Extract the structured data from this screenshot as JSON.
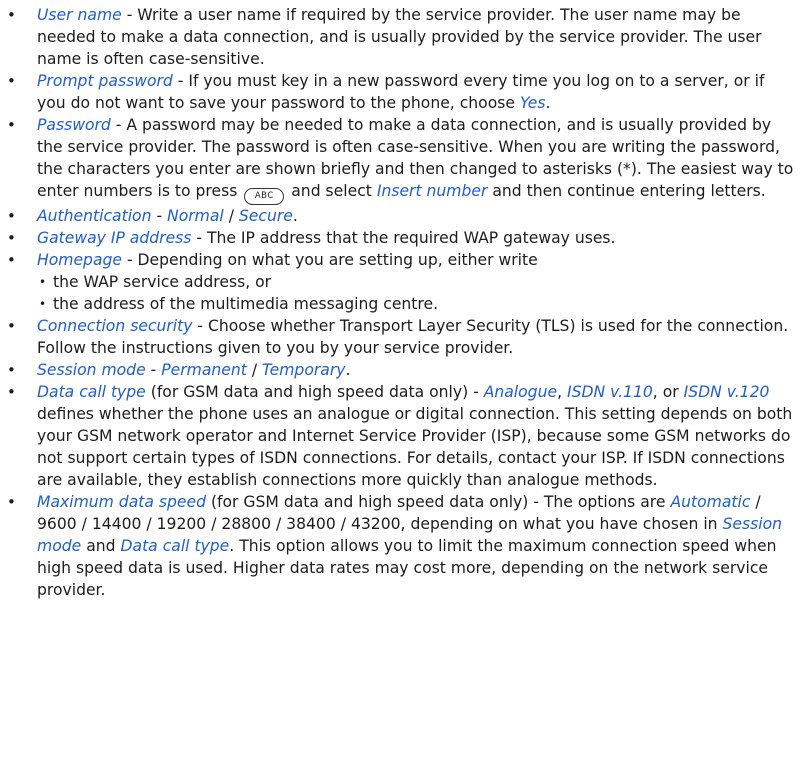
{
  "key_label": "ABC",
  "items": [
    {
      "title": "User name",
      "text": " - Write a user name if required by the service provider. The user name may be needed to make a data connection, and is usually provided by the service provider. The user name is often case-sensitive."
    },
    {
      "title": "Prompt password",
      "text": " - If you must key in a new password every time you log on to a server, or if you do not want to save your password to the phone, choose ",
      "opt": "Yes",
      "end": "."
    },
    {
      "title": "Password",
      "text1": " - A password may be needed to make a data connection, and is usually provided by the service provider. The password is often case-sensitive. When you are writing the password, the characters you enter are shown briefly and then changed to asterisks (*). The easiest way to enter numbers is to press ",
      "text2": " and select ",
      "opt": "Insert number",
      "text3": " and then continue entering letters."
    },
    {
      "title": "Authentication",
      "sep1": " - ",
      "opt1": "Normal",
      "sep2": " / ",
      "opt2": "Secure",
      "end": "."
    },
    {
      "title": "Gateway IP address",
      "text": " - The IP address that the required WAP gateway uses."
    },
    {
      "title": "Homepage",
      "text": " - Depending on what you are setting up, either write",
      "subitems": [
        "the WAP service address, or",
        "the address of the multimedia messaging centre."
      ]
    },
    {
      "title": "Connection security",
      "text": " - Choose whether Transport Layer Security (TLS) is used for the connection. Follow the instructions given to you by your service provider."
    },
    {
      "title": "Session mode",
      "sep1": " - ",
      "opt1": "Permanent",
      "sep2": " / ",
      "opt2": "Temporary",
      "end": "."
    },
    {
      "title": "Data call type",
      "text1": " (for GSM data and high speed data only) - ",
      "opt1": "Analogue",
      "sep1": ", ",
      "opt2": "ISDN v.110",
      "sep2": ", or ",
      "opt3": "ISDN v.120",
      "text2": " defines whether the phone uses an analogue or digital connection. This setting depends on both your GSM network operator and Internet Service Provider (ISP), because some GSM networks do not support certain types of ISDN connections. For details, contact your ISP. If ISDN connections are available, they establish connections more quickly than analogue methods."
    },
    {
      "title": "Maximum data speed",
      "text1": " (for GSM data and high speed data only) - The options are ",
      "opt1": "Automatic",
      "text2": " / 9600 / 14400 / 19200 / 28800 / 38400 / 43200, depending on what you have chosen in ",
      "opt2": "Session mode",
      "text3": " and ",
      "opt3": "Data call type",
      "text4": ". This option allows you to limit the maximum connection speed when high speed data is used. Higher data rates may cost more, depending on the network service provider."
    }
  ]
}
